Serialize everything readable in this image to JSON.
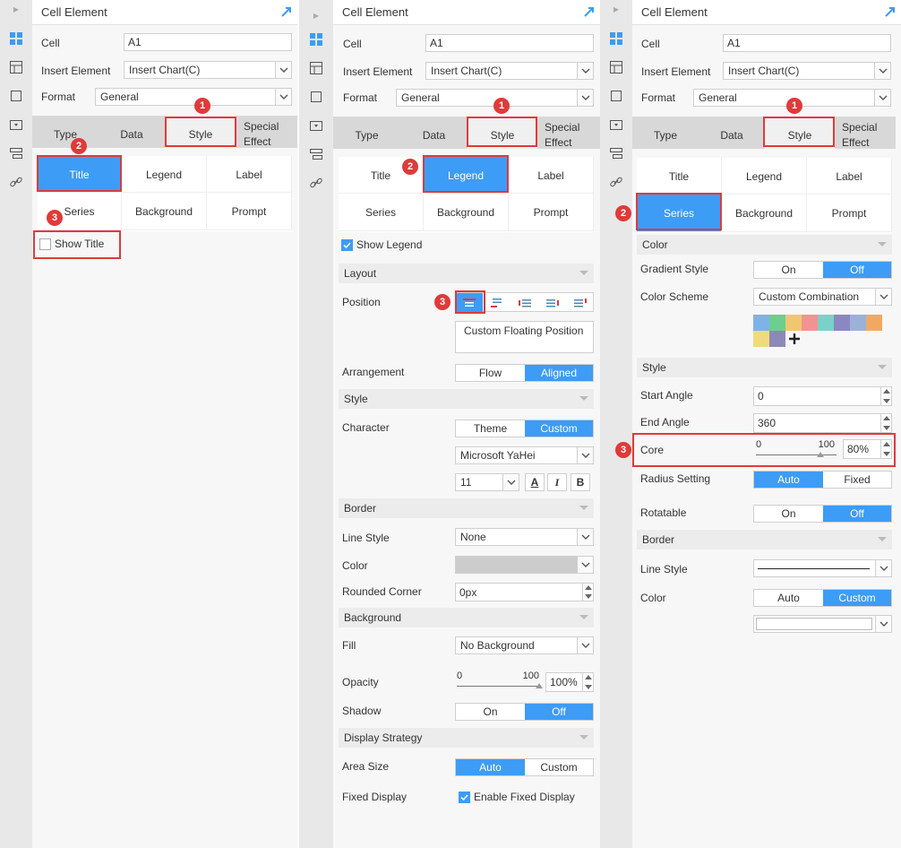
{
  "panel_title": "Cell Element",
  "labels": {
    "cell": "Cell",
    "insert_element": "Insert Element",
    "format": "Format"
  },
  "cell_value": "A1",
  "insert_value": "Insert Chart(C)",
  "format_value": "General",
  "tabs": [
    "Type",
    "Data",
    "Style",
    "Special Effect"
  ],
  "style_subtabs": [
    "Title",
    "Legend",
    "Label",
    "Series",
    "Background",
    "Prompt"
  ],
  "badges": [
    "1",
    "2",
    "3"
  ],
  "panel1": {
    "show_title": "Show Title"
  },
  "panel2": {
    "show_legend": "Show Legend",
    "layout_section": "Layout",
    "position": "Position",
    "custom_floating": "Custom Floating Position",
    "arrangement": "Arrangement",
    "arrangement_opts": [
      "Flow",
      "Aligned"
    ],
    "style_section": "Style",
    "character": "Character",
    "character_opts": [
      "Theme",
      "Custom"
    ],
    "font_name": "Microsoft YaHei",
    "font_size": "11",
    "font_buttons": [
      "A",
      "I",
      "B"
    ],
    "border_section": "Border",
    "line_style": "Line Style",
    "line_style_value": "None",
    "color": "Color",
    "rounded_corner": "Rounded Corner",
    "rounded_corner_value": "0px",
    "background_section": "Background",
    "fill": "Fill",
    "fill_value": "No Background",
    "opacity": "Opacity",
    "opacity_min": "0",
    "opacity_max": "100",
    "opacity_value": "100%",
    "opacity_level": 100,
    "shadow": "Shadow",
    "shadow_opts": [
      "On",
      "Off"
    ],
    "display_section": "Display Strategy",
    "area_size": "Area Size",
    "area_size_opts": [
      "Auto",
      "Custom"
    ],
    "fixed_display": "Fixed Display",
    "enable_fixed": "Enable Fixed Display"
  },
  "panel3": {
    "color_section": "Color",
    "gradient_style": "Gradient Style",
    "gradient_opts": [
      "On",
      "Off"
    ],
    "color_scheme": "Color Scheme",
    "color_scheme_value": "Custom Combination",
    "swatch_colors": [
      "#7eb3e8",
      "#6ccf8e",
      "#f2c66f",
      "#f29393",
      "#7bd1c8",
      "#8b87c4",
      "#9bb2d6",
      "#f2a860",
      "#f0da7d",
      "#8e88b8"
    ],
    "style_section": "Style",
    "start_angle": "Start Angle",
    "start_angle_value": "0",
    "end_angle": "End Angle",
    "end_angle_value": "360",
    "core": "Core",
    "core_min": "0",
    "core_max": "100",
    "core_value": "80%",
    "core_level": 80,
    "radius_setting": "Radius Setting",
    "radius_opts": [
      "Auto",
      "Fixed"
    ],
    "rotatable": "Rotatable",
    "rotatable_opts": [
      "On",
      "Off"
    ],
    "border_section": "Border",
    "line_style": "Line Style",
    "color": "Color",
    "color_opts": [
      "Auto",
      "Custom"
    ]
  },
  "accent_color": "#3d9cf5",
  "highlight_color": "#e03a3a"
}
